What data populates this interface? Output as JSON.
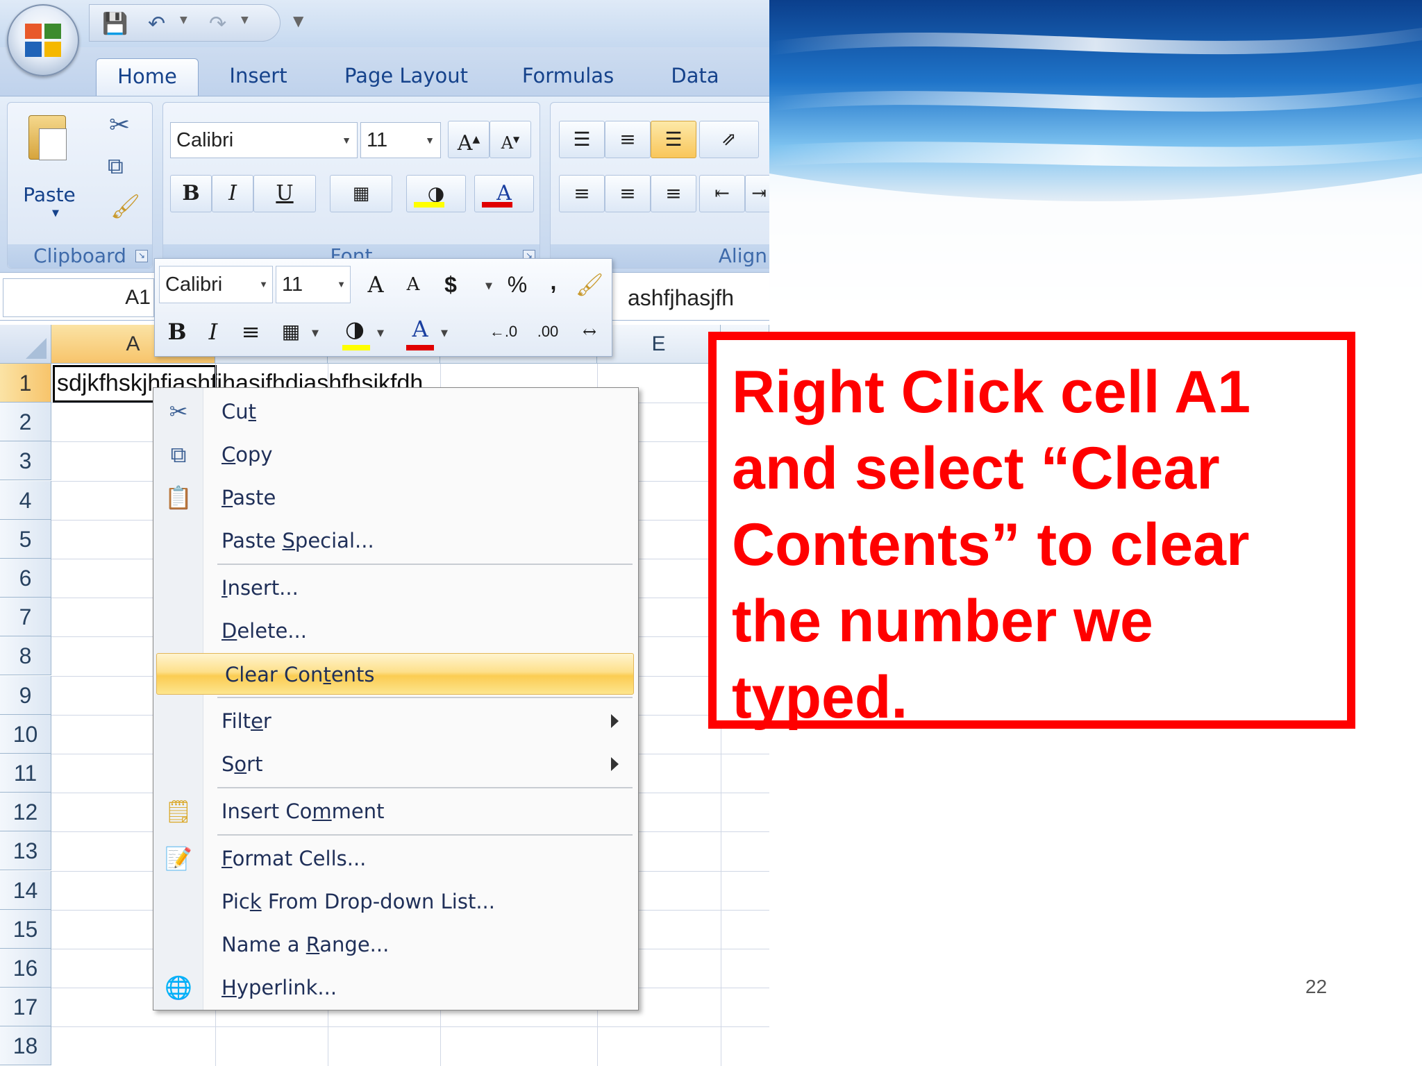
{
  "window": {
    "tabs": [
      "Home",
      "Insert",
      "Page Layout",
      "Formulas",
      "Data"
    ],
    "active_tab": "Home"
  },
  "ribbon": {
    "clipboard": {
      "paste_label": "Paste",
      "group_label": "Clipboard"
    },
    "font": {
      "font_name": "Calibri",
      "font_size": "11",
      "group_label": "Font"
    },
    "alignment": {
      "group_label": "Align"
    }
  },
  "formula_bar": {
    "name_box": "A1",
    "formula_text": "ashfjhasjfh"
  },
  "mini_toolbar": {
    "font_name": "Calibri",
    "font_size": "11",
    "currency": "$",
    "percent": "%",
    "comma": ","
  },
  "sheet": {
    "columns": [
      "A",
      "E"
    ],
    "selected_column": "A",
    "rows": [
      "1",
      "2",
      "3",
      "4",
      "5",
      "6",
      "7",
      "8",
      "9",
      "10",
      "11",
      "12",
      "13",
      "14",
      "15",
      "16",
      "17",
      "18"
    ],
    "selected_row": "1",
    "cell_a1": "sdjkfhskjhfjashfjhasjfhdjashfhsjkfdh"
  },
  "context_menu": {
    "items": [
      {
        "label": "Cut",
        "icon": "scissors-icon"
      },
      {
        "label": "Copy",
        "icon": "copy-icon"
      },
      {
        "label": "Paste",
        "icon": "paste-icon"
      },
      {
        "label": "Paste Special...",
        "icon": ""
      },
      {
        "label": "Insert...",
        "icon": ""
      },
      {
        "label": "Delete...",
        "icon": ""
      },
      {
        "label": "Clear Contents",
        "icon": "",
        "highlighted": true
      },
      {
        "label": "Filter",
        "icon": "",
        "submenu": true
      },
      {
        "label": "Sort",
        "icon": "",
        "submenu": true
      },
      {
        "label": "Insert Comment",
        "icon": "comment-icon"
      },
      {
        "label": "Format Cells...",
        "icon": "format-cells-icon"
      },
      {
        "label": "Pick From Drop-down List...",
        "icon": ""
      },
      {
        "label": "Name a Range...",
        "icon": ""
      },
      {
        "label": "Hyperlink...",
        "icon": "hyperlink-icon"
      }
    ]
  },
  "annotation": {
    "text": "Right Click cell A1 and select “Clear Contents” to clear the number we typed.",
    "color": "#ff0000"
  },
  "slide": {
    "page_number": "22"
  }
}
